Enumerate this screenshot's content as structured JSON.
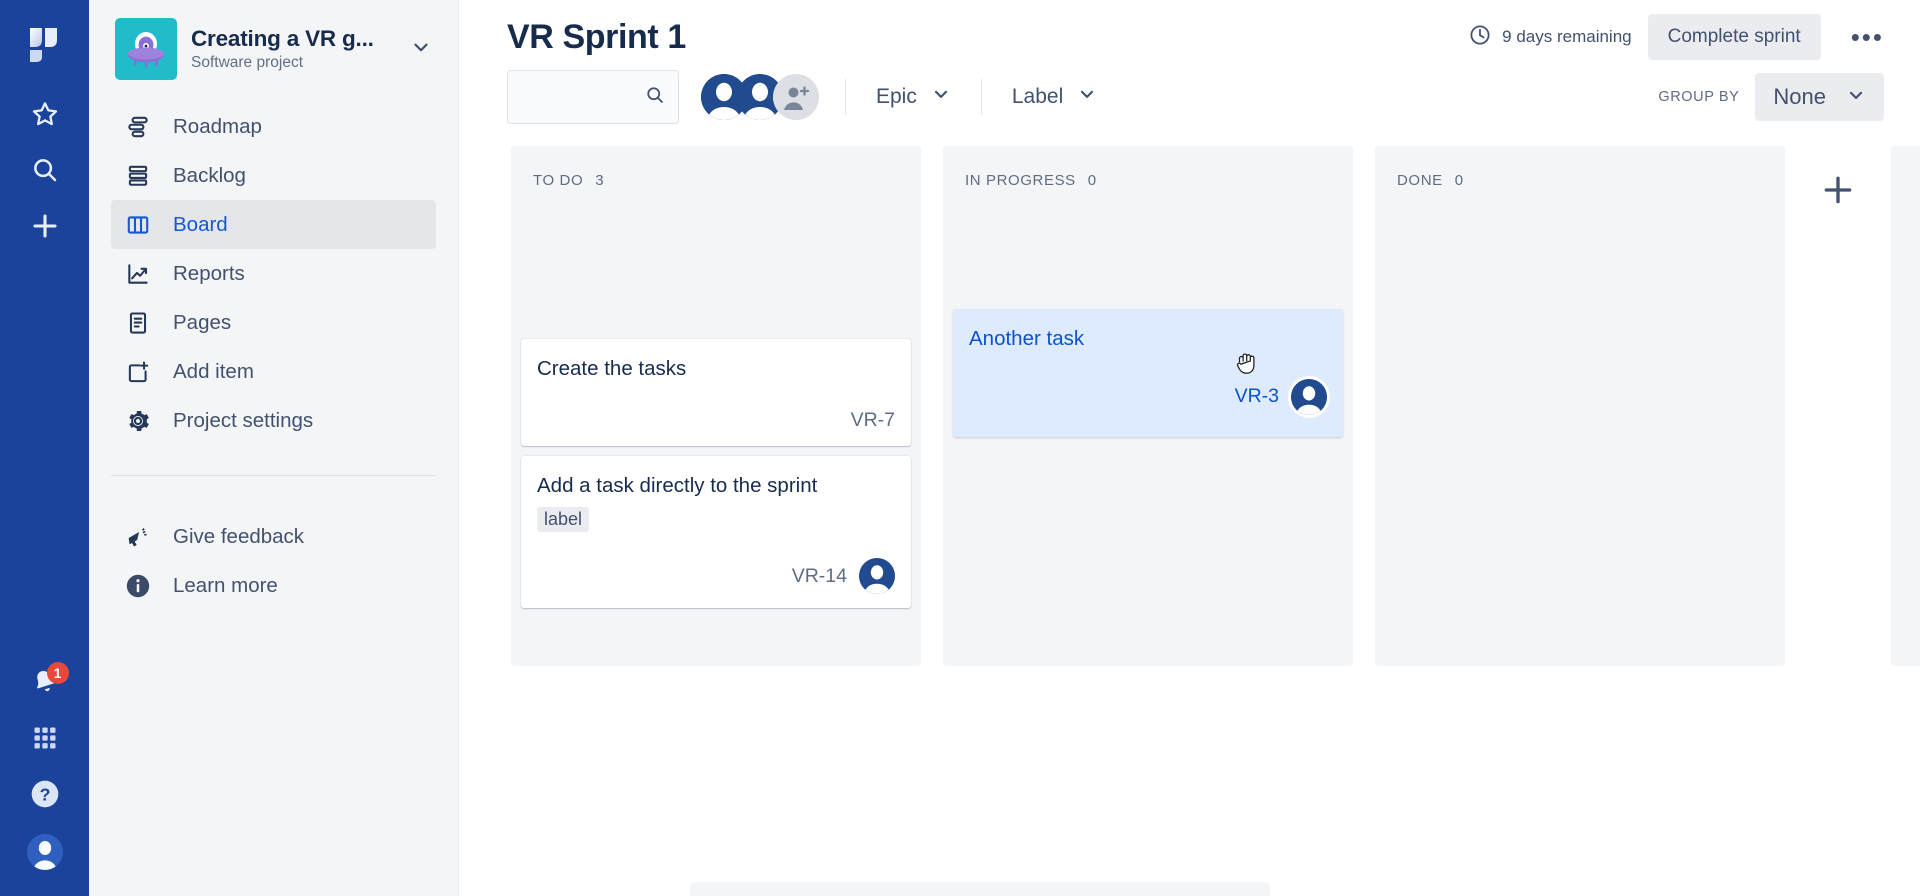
{
  "rail": {
    "logo_icon": "jira-logo-icon",
    "items": [
      {
        "icon": "star-icon",
        "name": "starred"
      },
      {
        "icon": "search-icon",
        "name": "search"
      },
      {
        "icon": "plus-icon",
        "name": "create"
      }
    ],
    "bottom": [
      {
        "icon": "bell-icon",
        "name": "notifications",
        "badge": "1"
      },
      {
        "icon": "apps-grid-icon",
        "name": "app-switcher"
      },
      {
        "icon": "help-circle-icon",
        "name": "help"
      },
      {
        "icon": "user-avatar-icon",
        "name": "profile"
      }
    ],
    "bg_color": "#1c439b"
  },
  "sidebar": {
    "project": {
      "name": "Creating a VR g...",
      "type": "Software project",
      "icon": "vr-ufo-project-icon",
      "icon_bg": "#21bcc9",
      "caret_icon": "chevron-down-icon"
    },
    "items": [
      {
        "label": "Roadmap",
        "icon": "roadmap-icon",
        "active": false
      },
      {
        "label": "Backlog",
        "icon": "backlog-icon",
        "active": false
      },
      {
        "label": "Board",
        "icon": "board-columns-icon",
        "active": true
      },
      {
        "label": "Reports",
        "icon": "reports-chart-icon",
        "active": false
      },
      {
        "label": "Pages",
        "icon": "pages-document-icon",
        "active": false
      },
      {
        "label": "Add item",
        "icon": "add-item-icon",
        "active": false
      },
      {
        "label": "Project settings",
        "icon": "gear-icon",
        "active": false
      }
    ],
    "footer_items": [
      {
        "label": "Give feedback",
        "icon": "megaphone-icon"
      },
      {
        "label": "Learn more",
        "icon": "info-circle-icon"
      }
    ],
    "active_color": "#1558d6",
    "bg_color": "#f4f5f7"
  },
  "header": {
    "title": "VR Sprint 1",
    "days_remaining": "9 days remaining",
    "clock_icon": "clock-icon",
    "complete_sprint_label": "Complete sprint",
    "more_label": "•••"
  },
  "toolbar": {
    "search": {
      "value": "",
      "placeholder": "",
      "icon": "search-icon"
    },
    "avatars": [
      {
        "name": "avatar-user-1",
        "type": "person"
      },
      {
        "name": "avatar-user-2",
        "type": "person"
      },
      {
        "name": "avatar-add-person",
        "type": "add"
      }
    ],
    "filters": [
      {
        "label": "Epic",
        "icon": "chevron-down-icon"
      },
      {
        "label": "Label",
        "icon": "chevron-down-icon"
      }
    ],
    "group_by": {
      "label": "GROUP BY",
      "value": "None",
      "icon": "chevron-down-icon"
    }
  },
  "board": {
    "columns": [
      {
        "name": "TO DO",
        "count": "3",
        "cards": [
          {
            "title": "Create the tasks",
            "key": "VR-7",
            "label": null,
            "assignee": null,
            "dragging": false,
            "offset": true
          },
          {
            "title": "Add a task directly to the sprint",
            "key": "VR-14",
            "label": "label",
            "assignee": "avatar-user",
            "dragging": false,
            "offset": false
          }
        ]
      },
      {
        "name": "IN PROGRESS",
        "count": "0",
        "cards": [
          {
            "title": "Another task",
            "key": "VR-3",
            "label": null,
            "assignee": "avatar-user",
            "dragging": true,
            "offset": false
          }
        ]
      },
      {
        "name": "DONE",
        "count": "0",
        "cards": []
      }
    ],
    "add_column_icon": "plus-icon",
    "column_bg": "#f4f5f7",
    "drag_card_bg": "#deebff",
    "drag_card_text_color": "#0b52cc",
    "cursor_icon": "grabbing-hand-cursor"
  }
}
